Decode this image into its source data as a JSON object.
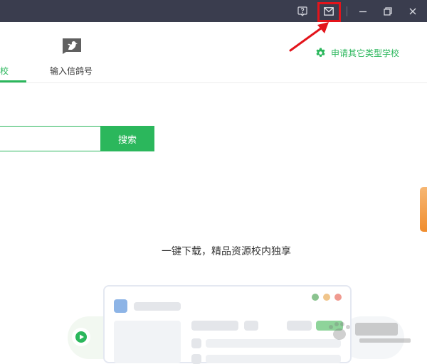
{
  "titlebar": {
    "help_icon": "help-question-icon",
    "mail_icon": "mail-envelope-icon",
    "minimize_icon": "minimize-icon",
    "restore_icon": "restore-icon",
    "close_icon": "close-icon"
  },
  "tabs": {
    "active_label": "校",
    "pigeon_label": "输入信鸽号"
  },
  "apply": {
    "label": "申请其它类型学校",
    "icon": "gear-icon"
  },
  "search": {
    "value": "",
    "placeholder": "",
    "button_label": "搜索"
  },
  "promo": {
    "text": "一键下载，精品资源校内独享"
  },
  "colors": {
    "titlebar": "#3a3d4e",
    "accent": "#2bb75c",
    "highlight": "#e3141b",
    "scroll": "#f08d2e"
  }
}
